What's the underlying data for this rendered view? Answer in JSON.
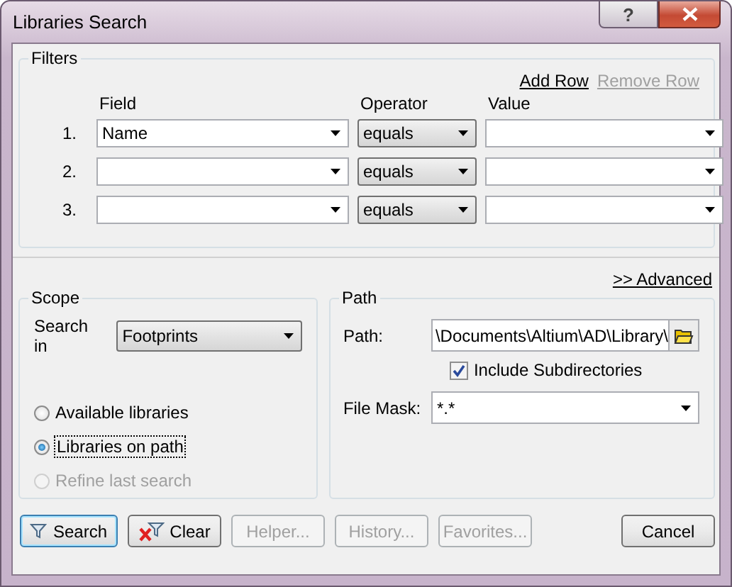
{
  "window": {
    "title": "Libraries Search",
    "help": "?"
  },
  "filters": {
    "title": "Filters",
    "add_row": {
      "label": "Add Row",
      "disabled": false
    },
    "remove_row": {
      "label": "Remove Row",
      "disabled": true
    },
    "columns": [
      "Field",
      "Operator",
      "Value"
    ],
    "rows": [
      {
        "number": "1.",
        "field": "Name",
        "operator": "equals"
      },
      {
        "number": "2.",
        "operator": "equals"
      },
      {
        "number": "3.",
        "operator": "equals"
      }
    ]
  },
  "advanced_link": ">> Advanced",
  "scope": {
    "title": "Scope",
    "search_in_label": "Search in",
    "search_in": "Footprints",
    "options": [
      {
        "label": "Available libraries",
        "selected": false,
        "disabled": false,
        "focused": false
      },
      {
        "label": "Libraries on path",
        "selected": true,
        "disabled": false,
        "focused": true
      },
      {
        "label": "Refine last search",
        "selected": false,
        "disabled": true,
        "focused": false
      }
    ]
  },
  "path": {
    "title": "Path",
    "path_label": "Path:",
    "path": "\\Documents\\Altium\\AD\\Library\\",
    "include_subdirectories": {
      "label": "Include Subdirectories",
      "checked": true
    },
    "file_mask_label": "File Mask:",
    "file_mask": "*.*"
  },
  "buttons": [
    {
      "label": "Search",
      "kind": "search",
      "disabled": false,
      "focused": true
    },
    {
      "label": "Clear",
      "kind": "clear",
      "disabled": false,
      "focused": false
    },
    {
      "label": "Helper...",
      "kind": "plain",
      "disabled": true,
      "focused": false
    },
    {
      "label": "History...",
      "kind": "plain",
      "disabled": true,
      "focused": false
    },
    {
      "label": "Favorites...",
      "kind": "plain",
      "disabled": true,
      "focused": false
    },
    {
      "label": "Cancel",
      "kind": "cancel",
      "disabled": false,
      "focused": false
    }
  ]
}
